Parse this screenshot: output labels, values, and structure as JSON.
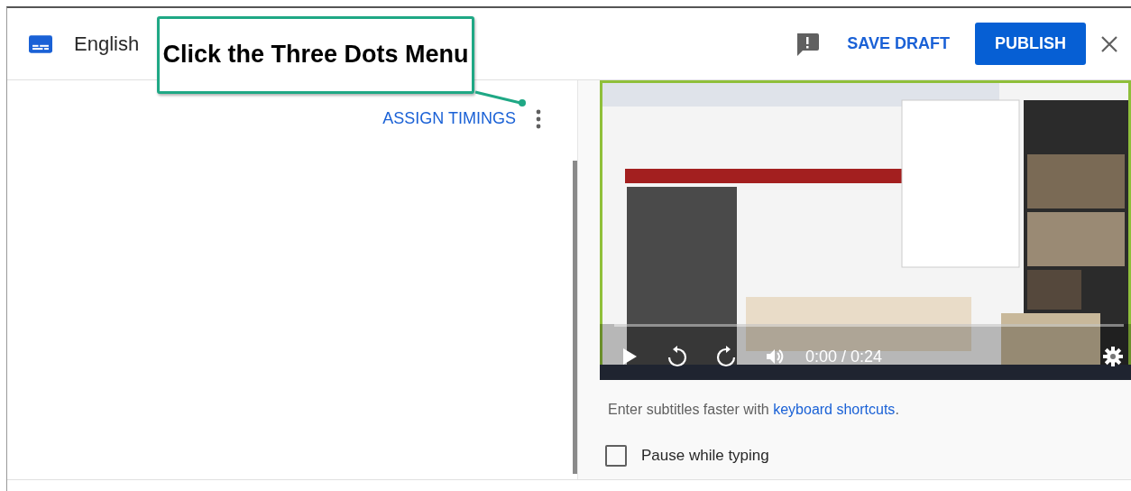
{
  "header": {
    "title": "English",
    "save": "SAVE DRAFT",
    "publish": "PUBLISH"
  },
  "editor": {
    "assign": "ASSIGN TIMINGS"
  },
  "annotation": {
    "text": "Click the Three Dots Menu"
  },
  "player": {
    "time": "0:00 / 0:24"
  },
  "hint": {
    "text": "Enter subtitles faster with ",
    "link": "keyboard shortcuts",
    "end": "."
  },
  "options": [
    {
      "label": "Pause while typing",
      "checked": false
    }
  ]
}
